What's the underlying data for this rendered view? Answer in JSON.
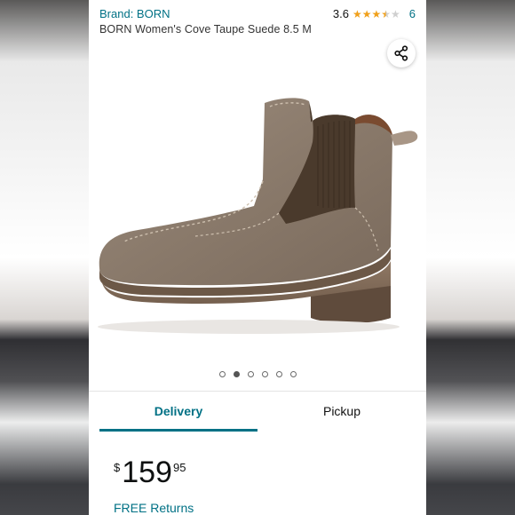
{
  "header": {
    "brand": "Brand: BORN",
    "rating_value": "3.6",
    "rating": 3.6,
    "rating_count": "6",
    "title": "BORN Women's Cove Taupe Suede 8.5 M"
  },
  "gallery": {
    "total_images": 6,
    "active_index": 1
  },
  "tabs": [
    {
      "label": "Delivery",
      "active": true
    },
    {
      "label": "Pickup",
      "active": false
    }
  ],
  "price": {
    "symbol": "$",
    "whole": "159",
    "fraction": "95"
  },
  "returns": "FREE Returns",
  "colors": {
    "link": "#007185",
    "star": "#f0a01a"
  }
}
